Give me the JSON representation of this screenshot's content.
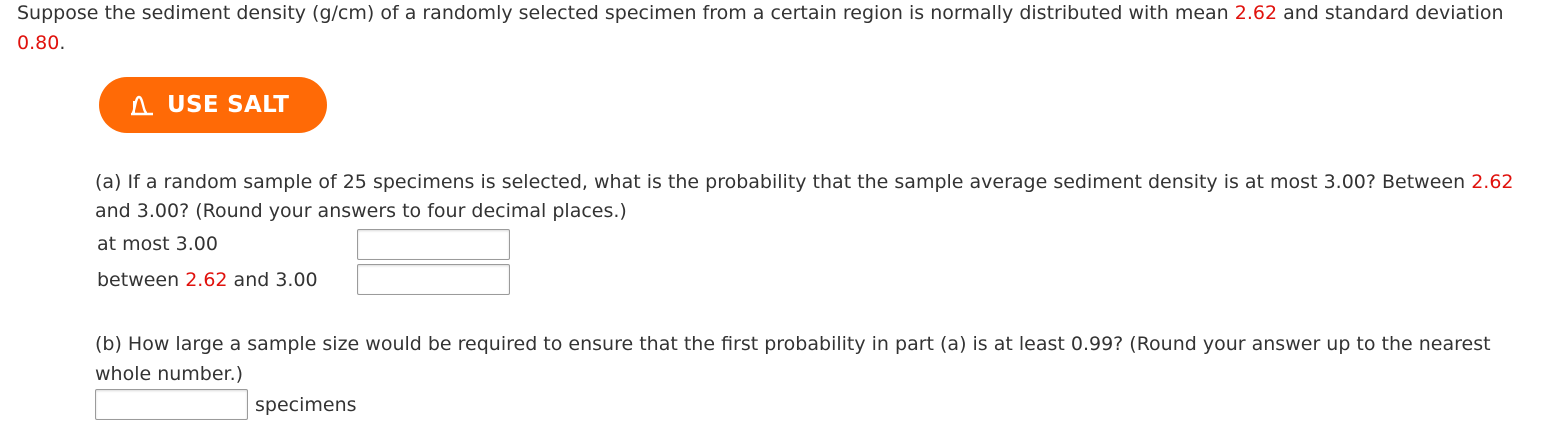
{
  "intro": {
    "line1_pre": "Suppose the sediment density (g/cm) of a randomly selected specimen from a certain region is normally distributed with mean ",
    "mean": "2.62",
    "line1_mid": " and standard deviation",
    "sd": "0.80",
    "line2_post": "."
  },
  "salt_button": {
    "label": "USE SALT",
    "icon": "salt-logo-icon",
    "color": "#ff6a06"
  },
  "part_a": {
    "line1_pre": "(a) If a random sample of 25 specimens is selected, what is the probability that the sample average sediment density is at most 3.00? Between ",
    "line1_red": "2.62",
    "line2": "and 3.00? (Round your answers to four decimal places.)",
    "row1_label": "at most 3.00",
    "row1_value": "",
    "row2_pre": "between ",
    "row2_red": "2.62",
    "row2_post": " and 3.00",
    "row2_value": ""
  },
  "part_b": {
    "line1": "(b) How large a sample size would be required to ensure that the first probability in part (a) is at least 0.99? (Round your answer up to the nearest",
    "line2": "whole number.)",
    "value": "",
    "unit": "specimens"
  },
  "colors": {
    "highlight": "#e0120d",
    "text": "#333333"
  }
}
